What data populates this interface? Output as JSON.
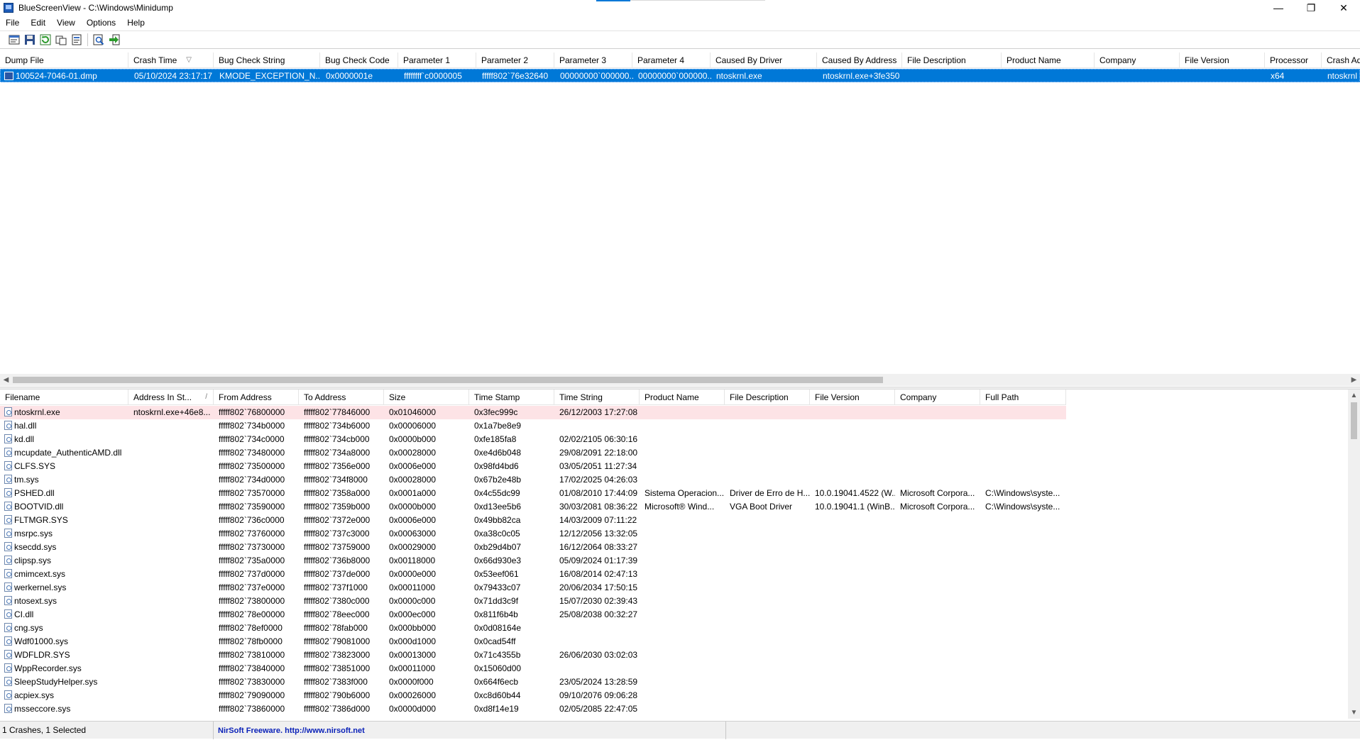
{
  "window": {
    "title": "BlueScreenView - C:\\Windows\\Minidump",
    "controls": {
      "minimize": "—",
      "restore": "❐",
      "close": "✕"
    }
  },
  "menu": [
    "File",
    "Edit",
    "View",
    "Options",
    "Help"
  ],
  "toolbar": {
    "buttons": [
      "properties-icon",
      "save-icon",
      "refresh-icon",
      "copy-icon",
      "report-icon",
      "find-icon",
      "exit-icon"
    ]
  },
  "crash_grid": {
    "columns": [
      "Dump File",
      "Crash Time",
      "Bug Check String",
      "Bug Check Code",
      "Parameter 1",
      "Parameter 2",
      "Parameter 3",
      "Parameter 4",
      "Caused By Driver",
      "Caused By Address",
      "File Description",
      "Product Name",
      "Company",
      "File Version",
      "Processor",
      "Crash Ad"
    ],
    "sort_indicator": "▽",
    "rows": [
      [
        "100524-7046-01.dmp",
        "05/10/2024 23:17:17",
        "KMODE_EXCEPTION_N...",
        "0x0000001e",
        "ffffffff`c0000005",
        "fffff802`76e32640",
        "00000000`000000...",
        "00000000`000000...",
        "ntoskrnl.exe",
        "ntoskrnl.exe+3fe350",
        "",
        "",
        "",
        "",
        "x64",
        "ntoskrnl."
      ]
    ]
  },
  "module_grid": {
    "columns": [
      "Filename",
      "Address In St...",
      "From Address",
      "To Address",
      "Size",
      "Time Stamp",
      "Time String",
      "Product Name",
      "File Description",
      "File Version",
      "Company",
      "Full Path"
    ],
    "sort_indicator": "/",
    "rows": [
      [
        "ntoskrnl.exe",
        "ntoskrnl.exe+46e8...",
        "fffff802`76800000",
        "fffff802`77846000",
        "0x01046000",
        "0x3fec999c",
        "26/12/2003 17:27:08",
        "",
        "",
        "",
        "",
        ""
      ],
      [
        "hal.dll",
        "",
        "fffff802`734b0000",
        "fffff802`734b6000",
        "0x00006000",
        "0x1a7be8e9",
        "",
        "",
        "",
        "",
        "",
        ""
      ],
      [
        "kd.dll",
        "",
        "fffff802`734c0000",
        "fffff802`734cb000",
        "0x0000b000",
        "0xfe185fa8",
        "02/02/2105 06:30:16",
        "",
        "",
        "",
        "",
        ""
      ],
      [
        "mcupdate_AuthenticAMD.dll",
        "",
        "fffff802`73480000",
        "fffff802`734a8000",
        "0x00028000",
        "0xe4d6b048",
        "29/08/2091 22:18:00",
        "",
        "",
        "",
        "",
        ""
      ],
      [
        "CLFS.SYS",
        "",
        "fffff802`73500000",
        "fffff802`7356e000",
        "0x0006e000",
        "0x98fd4bd6",
        "03/05/2051 11:27:34",
        "",
        "",
        "",
        "",
        ""
      ],
      [
        "tm.sys",
        "",
        "fffff802`734d0000",
        "fffff802`734f8000",
        "0x00028000",
        "0x67b2e48b",
        "17/02/2025 04:26:03",
        "",
        "",
        "",
        "",
        ""
      ],
      [
        "PSHED.dll",
        "",
        "fffff802`73570000",
        "fffff802`7358a000",
        "0x0001a000",
        "0x4c55dc99",
        "01/08/2010 17:44:09",
        "Sistema Operacion...",
        "Driver de Erro de H...",
        "10.0.19041.4522 (W...",
        "Microsoft Corpora...",
        "C:\\Windows\\syste..."
      ],
      [
        "BOOTVID.dll",
        "",
        "fffff802`73590000",
        "fffff802`7359b000",
        "0x0000b000",
        "0xd13ee5b6",
        "30/03/2081 08:36:22",
        "Microsoft® Wind...",
        "VGA Boot Driver",
        "10.0.19041.1 (WinB...",
        "Microsoft Corpora...",
        "C:\\Windows\\syste..."
      ],
      [
        "FLTMGR.SYS",
        "",
        "fffff802`736c0000",
        "fffff802`7372e000",
        "0x0006e000",
        "0x49bb82ca",
        "14/03/2009 07:11:22",
        "",
        "",
        "",
        "",
        ""
      ],
      [
        "msrpc.sys",
        "",
        "fffff802`73760000",
        "fffff802`737c3000",
        "0x00063000",
        "0xa38c0c05",
        "12/12/2056 13:32:05",
        "",
        "",
        "",
        "",
        ""
      ],
      [
        "ksecdd.sys",
        "",
        "fffff802`73730000",
        "fffff802`73759000",
        "0x00029000",
        "0xb29d4b07",
        "16/12/2064 08:33:27",
        "",
        "",
        "",
        "",
        ""
      ],
      [
        "clipsp.sys",
        "",
        "fffff802`735a0000",
        "fffff802`736b8000",
        "0x00118000",
        "0x66d930e3",
        "05/09/2024 01:17:39",
        "",
        "",
        "",
        "",
        ""
      ],
      [
        "cmimcext.sys",
        "",
        "fffff802`737d0000",
        "fffff802`737de000",
        "0x0000e000",
        "0x53eef061",
        "16/08/2014 02:47:13",
        "",
        "",
        "",
        "",
        ""
      ],
      [
        "werkernel.sys",
        "",
        "fffff802`737e0000",
        "fffff802`737f1000",
        "0x00011000",
        "0x79433c07",
        "20/06/2034 17:50:15",
        "",
        "",
        "",
        "",
        ""
      ],
      [
        "ntosext.sys",
        "",
        "fffff802`73800000",
        "fffff802`7380c000",
        "0x0000c000",
        "0x71dd3c9f",
        "15/07/2030 02:39:43",
        "",
        "",
        "",
        "",
        ""
      ],
      [
        "CI.dll",
        "",
        "fffff802`78e00000",
        "fffff802`78eec000",
        "0x000ec000",
        "0x811f6b4b",
        "25/08/2038 00:32:27",
        "",
        "",
        "",
        "",
        ""
      ],
      [
        "cng.sys",
        "",
        "fffff802`78ef0000",
        "fffff802`78fab000",
        "0x000bb000",
        "0x0d08164e",
        "",
        "",
        "",
        "",
        "",
        ""
      ],
      [
        "Wdf01000.sys",
        "",
        "fffff802`78fb0000",
        "fffff802`79081000",
        "0x000d1000",
        "0x0cad54ff",
        "",
        "",
        "",
        "",
        "",
        ""
      ],
      [
        "WDFLDR.SYS",
        "",
        "fffff802`73810000",
        "fffff802`73823000",
        "0x00013000",
        "0x71c4355b",
        "26/06/2030 03:02:03",
        "",
        "",
        "",
        "",
        ""
      ],
      [
        "WppRecorder.sys",
        "",
        "fffff802`73840000",
        "fffff802`73851000",
        "0x00011000",
        "0x15060d00",
        "",
        "",
        "",
        "",
        "",
        ""
      ],
      [
        "SleepStudyHelper.sys",
        "",
        "fffff802`73830000",
        "fffff802`7383f000",
        "0x0000f000",
        "0x664f6ecb",
        "23/05/2024 13:28:59",
        "",
        "",
        "",
        "",
        ""
      ],
      [
        "acpiex.sys",
        "",
        "fffff802`79090000",
        "fffff802`790b6000",
        "0x00026000",
        "0xc8d60b44",
        "09/10/2076 09:06:28",
        "",
        "",
        "",
        "",
        ""
      ],
      [
        "msseccore.sys",
        "",
        "fffff802`73860000",
        "fffff802`7386d000",
        "0x0000d000",
        "0xd8f14e19",
        "02/05/2085 22:47:05",
        "",
        "",
        "",
        "",
        ""
      ]
    ]
  },
  "status": {
    "summary": "1 Crashes, 1 Selected",
    "credit": "NirSoft Freeware.  http://www.nirsoft.net"
  },
  "colors": {
    "selection": "#0078d7",
    "highlight_row": "#fde3e6",
    "link": "#0b22b8"
  }
}
